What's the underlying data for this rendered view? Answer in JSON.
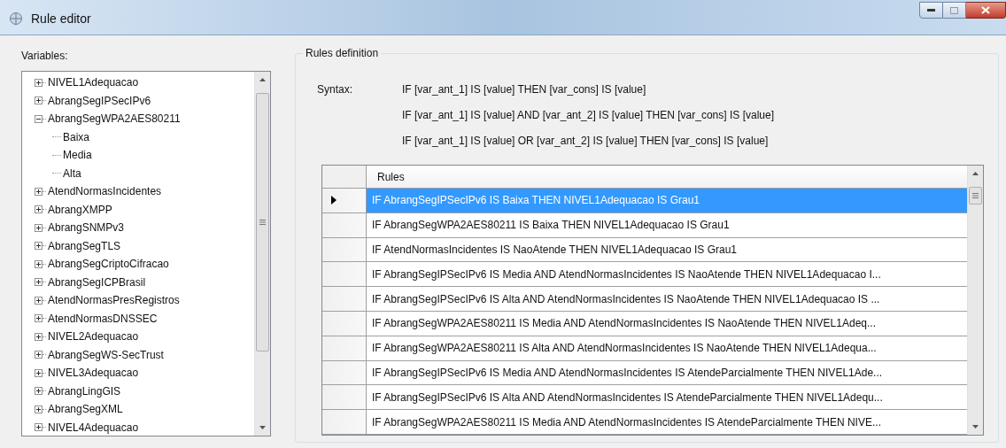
{
  "window": {
    "title": "Rule editor"
  },
  "variables": {
    "label": "Variables:",
    "tree": [
      {
        "label": "NIVEL1Adequacao",
        "expanded": false
      },
      {
        "label": "AbrangSegIPSecIPv6",
        "expanded": false
      },
      {
        "label": "AbrangSegWPA2AES80211",
        "expanded": true,
        "children": [
          {
            "label": "Baixa"
          },
          {
            "label": "Media"
          },
          {
            "label": "Alta"
          }
        ]
      },
      {
        "label": "AtendNormasIncidentes",
        "expanded": false
      },
      {
        "label": "AbrangXMPP",
        "expanded": false
      },
      {
        "label": "AbrangSNMPv3",
        "expanded": false
      },
      {
        "label": "AbrangSegTLS",
        "expanded": false
      },
      {
        "label": "AbrangSegCriptoCifracao",
        "expanded": false
      },
      {
        "label": "AbrangSegICPBrasil",
        "expanded": false
      },
      {
        "label": "AtendNormasPresRegistros",
        "expanded": false
      },
      {
        "label": "AtendNormasDNSSEC",
        "expanded": false
      },
      {
        "label": "NIVEL2Adequacao",
        "expanded": false
      },
      {
        "label": "AbrangSegWS-SecTrust",
        "expanded": false
      },
      {
        "label": "NIVEL3Adequacao",
        "expanded": false
      },
      {
        "label": "AbrangLingGIS",
        "expanded": false
      },
      {
        "label": "AbrangSegXML",
        "expanded": false
      },
      {
        "label": "NIVEL4Adequacao",
        "expanded": false
      }
    ]
  },
  "rules_definition": {
    "title": "Rules definition",
    "syntax_label": "Syntax:",
    "syntax": [
      "IF [var_ant_1] IS [value] THEN [var_cons] IS [value]",
      "IF [var_ant_1] IS [value] AND [var_ant_2] IS [value] THEN [var_cons] IS [value]",
      "IF [var_ant_1] IS [value] OR [var_ant_2] IS [value] THEN [var_cons] IS [value]"
    ],
    "table": {
      "columns": [
        "Rules"
      ],
      "rows": [
        {
          "rule": "IF AbrangSegIPSecIPv6 IS Baixa THEN NIVEL1Adequacao IS Grau1",
          "selected": true
        },
        {
          "rule": "IF AbrangSegWPA2AES80211 IS Baixa THEN NIVEL1Adequacao IS Grau1",
          "selected": false
        },
        {
          "rule": "IF AtendNormasIncidentes IS NaoAtende THEN NIVEL1Adequacao IS Grau1",
          "selected": false
        },
        {
          "rule": "IF AbrangSegIPSecIPv6 IS Media AND AtendNormasIncidentes IS NaoAtende THEN NIVEL1Adequacao I...",
          "selected": false
        },
        {
          "rule": "IF AbrangSegIPSecIPv6 IS Alta AND AtendNormasIncidentes IS NaoAtende THEN NIVEL1Adequacao IS ...",
          "selected": false
        },
        {
          "rule": "IF AbrangSegWPA2AES80211 IS Media AND AtendNormasIncidentes IS NaoAtende THEN NIVEL1Adeq...",
          "selected": false
        },
        {
          "rule": "IF AbrangSegWPA2AES80211 IS Alta AND AtendNormasIncidentes IS NaoAtende THEN NIVEL1Adequa...",
          "selected": false
        },
        {
          "rule": "IF AbrangSegIPSecIPv6 IS Media AND AtendNormasIncidentes IS AtendeParcialmente THEN NIVEL1Ade...",
          "selected": false
        },
        {
          "rule": "IF AbrangSegIPSecIPv6 IS Alta AND AtendNormasIncidentes IS AtendeParcialmente THEN NIVEL1Adequ...",
          "selected": false
        },
        {
          "rule": "IF AbrangSegWPA2AES80211 IS Media AND AtendNormasIncidentes IS AtendeParcialmente THEN NIVE...",
          "selected": false
        }
      ]
    }
  }
}
